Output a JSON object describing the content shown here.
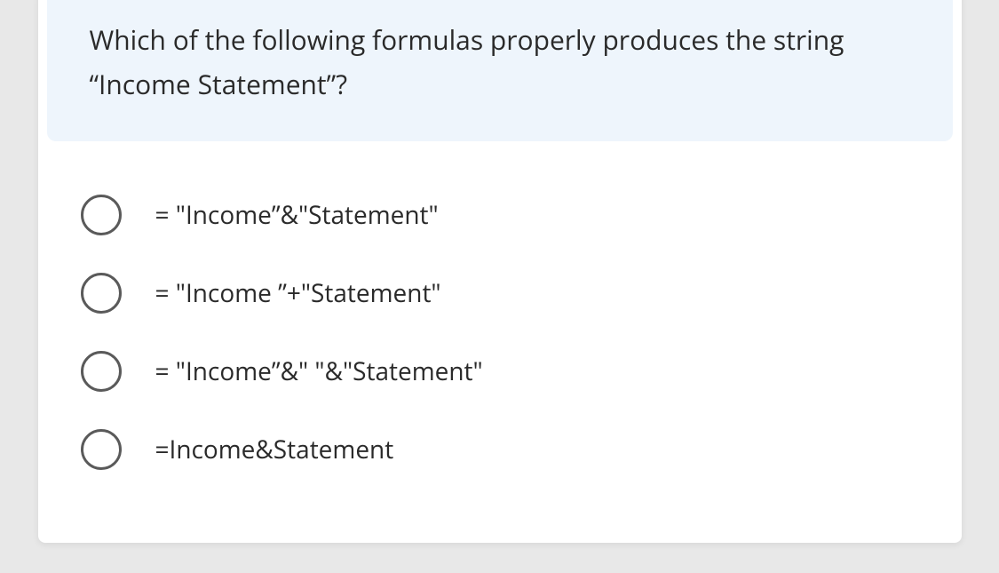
{
  "question": {
    "text": "Which of the following formulas properly produces the string “Income Statement”?"
  },
  "options": [
    {
      "label": "= \"Income”&\"Statement\""
    },
    {
      "label": "= \"Income ”+\"Statement\""
    },
    {
      "label": "= \"Income”&\" \"&\"Statement\""
    },
    {
      "label": "=Income&Statement"
    }
  ]
}
